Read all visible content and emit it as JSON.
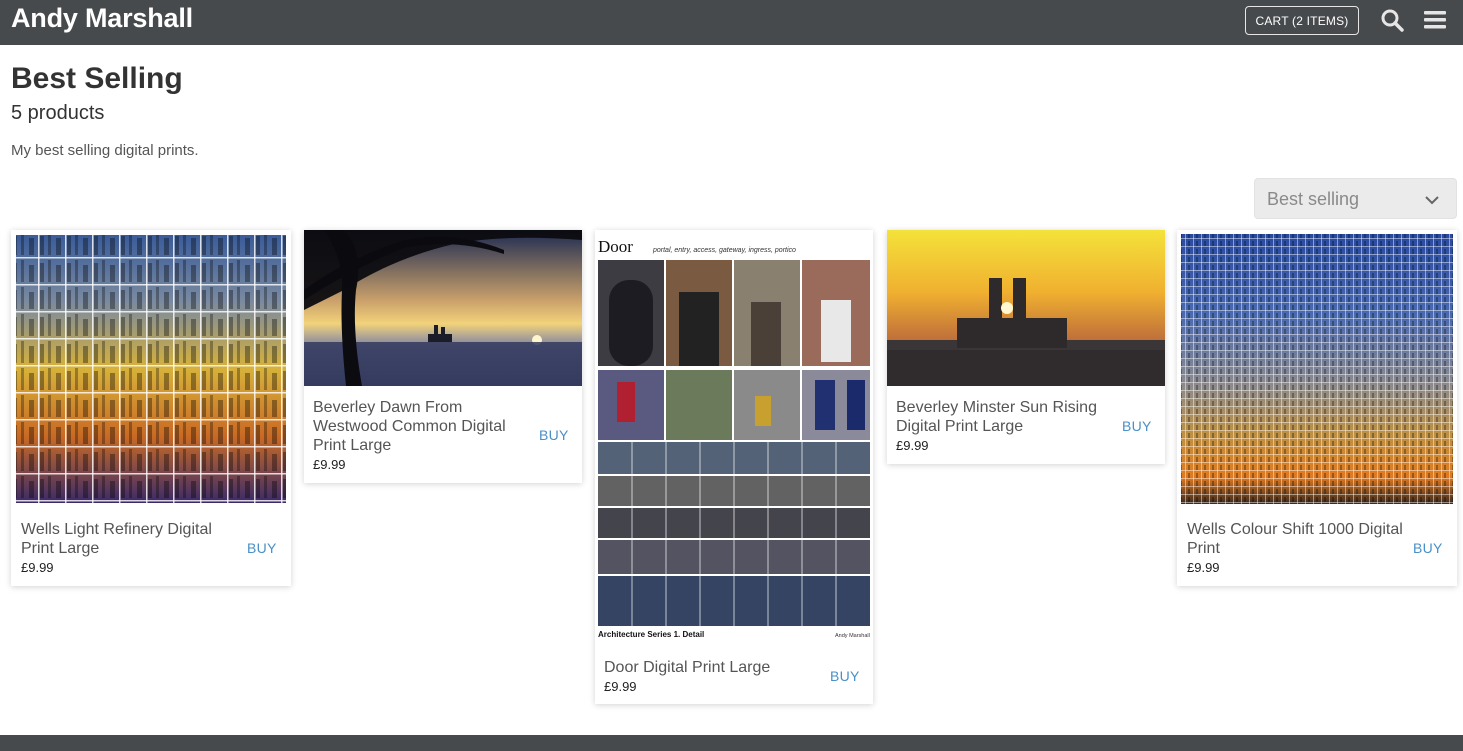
{
  "header": {
    "brand": "Andy Marshall",
    "cart_label": "CART (2 ITEMS)",
    "icons": [
      "search-icon",
      "menu-icon"
    ]
  },
  "collection": {
    "title": "Best Selling",
    "count": "5 products",
    "description": "My best selling digital prints."
  },
  "sort": {
    "selected": "Best selling",
    "icon": "chevron-down-icon"
  },
  "products": [
    {
      "name": "Wells Light Refinery Digital Print Large",
      "price": "£9.99",
      "buy": "BUY"
    },
    {
      "name": "Beverley Dawn From Westwood Common Digital Print Large",
      "price": "£9.99",
      "buy": "BUY"
    },
    {
      "name": "Door Digital Print Large",
      "price": "£9.99",
      "buy": "BUY",
      "poster": {
        "title": "Door",
        "subtitle": "portal, entry, access, gateway, ingress, portico",
        "series": "Architecture Series 1. Detail",
        "author": "Andy Marshall"
      }
    },
    {
      "name": "Beverley Minster Sun Rising Digital Print Large",
      "price": "£9.99",
      "buy": "BUY"
    },
    {
      "name": "Wells Colour Shift 1000 Digital Print",
      "price": "£9.99",
      "buy": "BUY"
    }
  ],
  "colors": {
    "header_bg": "#464a4c",
    "link": "#4a90c8",
    "select_bg": "#ebebeb"
  }
}
